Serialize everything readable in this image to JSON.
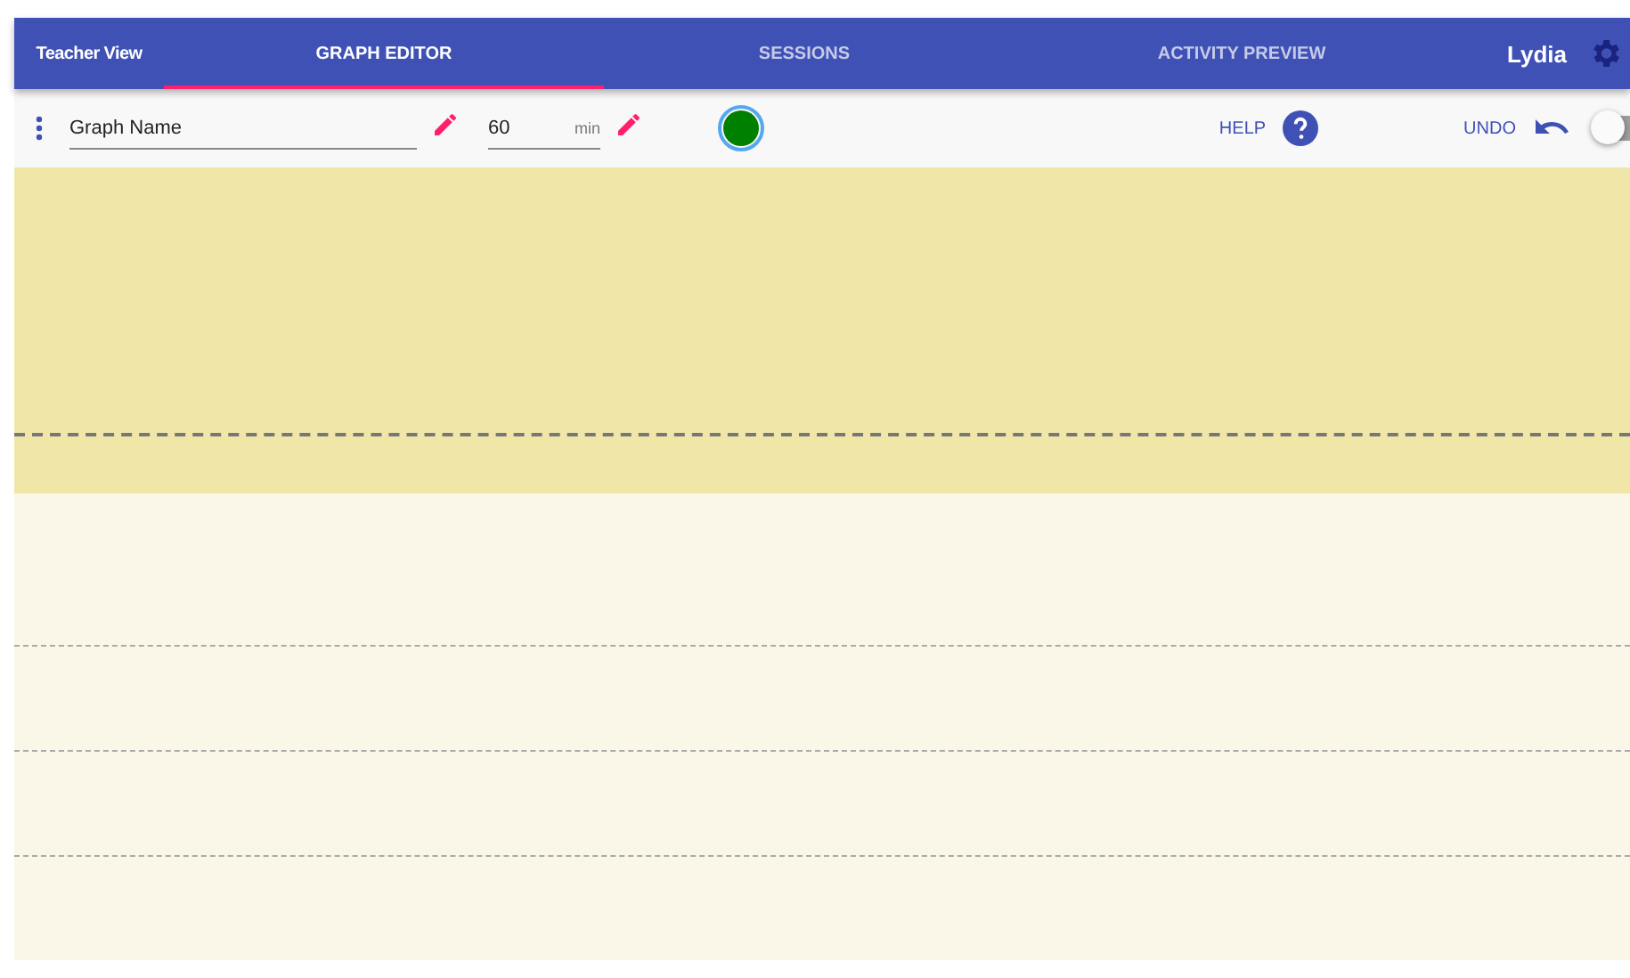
{
  "header": {
    "title": "Teacher View",
    "tabs": [
      {
        "label": "GRAPH EDITOR",
        "selected": true
      },
      {
        "label": "SESSIONS",
        "selected": false
      },
      {
        "label": "ACTIVITY PREVIEW",
        "selected": false
      }
    ],
    "user": "Lydia"
  },
  "toolbar": {
    "graph_name": "Graph Name",
    "duration": "60",
    "duration_unit": "min",
    "color": "#008000",
    "help": "HELP",
    "undo": "UNDO",
    "toggle": {
      "on": false
    }
  },
  "canvas": {
    "bands": [
      {
        "kind": "upper",
        "lines": [
          {
            "kind": "dashed"
          }
        ]
      },
      {
        "kind": "lower",
        "lines": [
          {
            "kind": "dotted"
          },
          {
            "kind": "dotted"
          },
          {
            "kind": "dotted"
          }
        ]
      }
    ]
  }
}
